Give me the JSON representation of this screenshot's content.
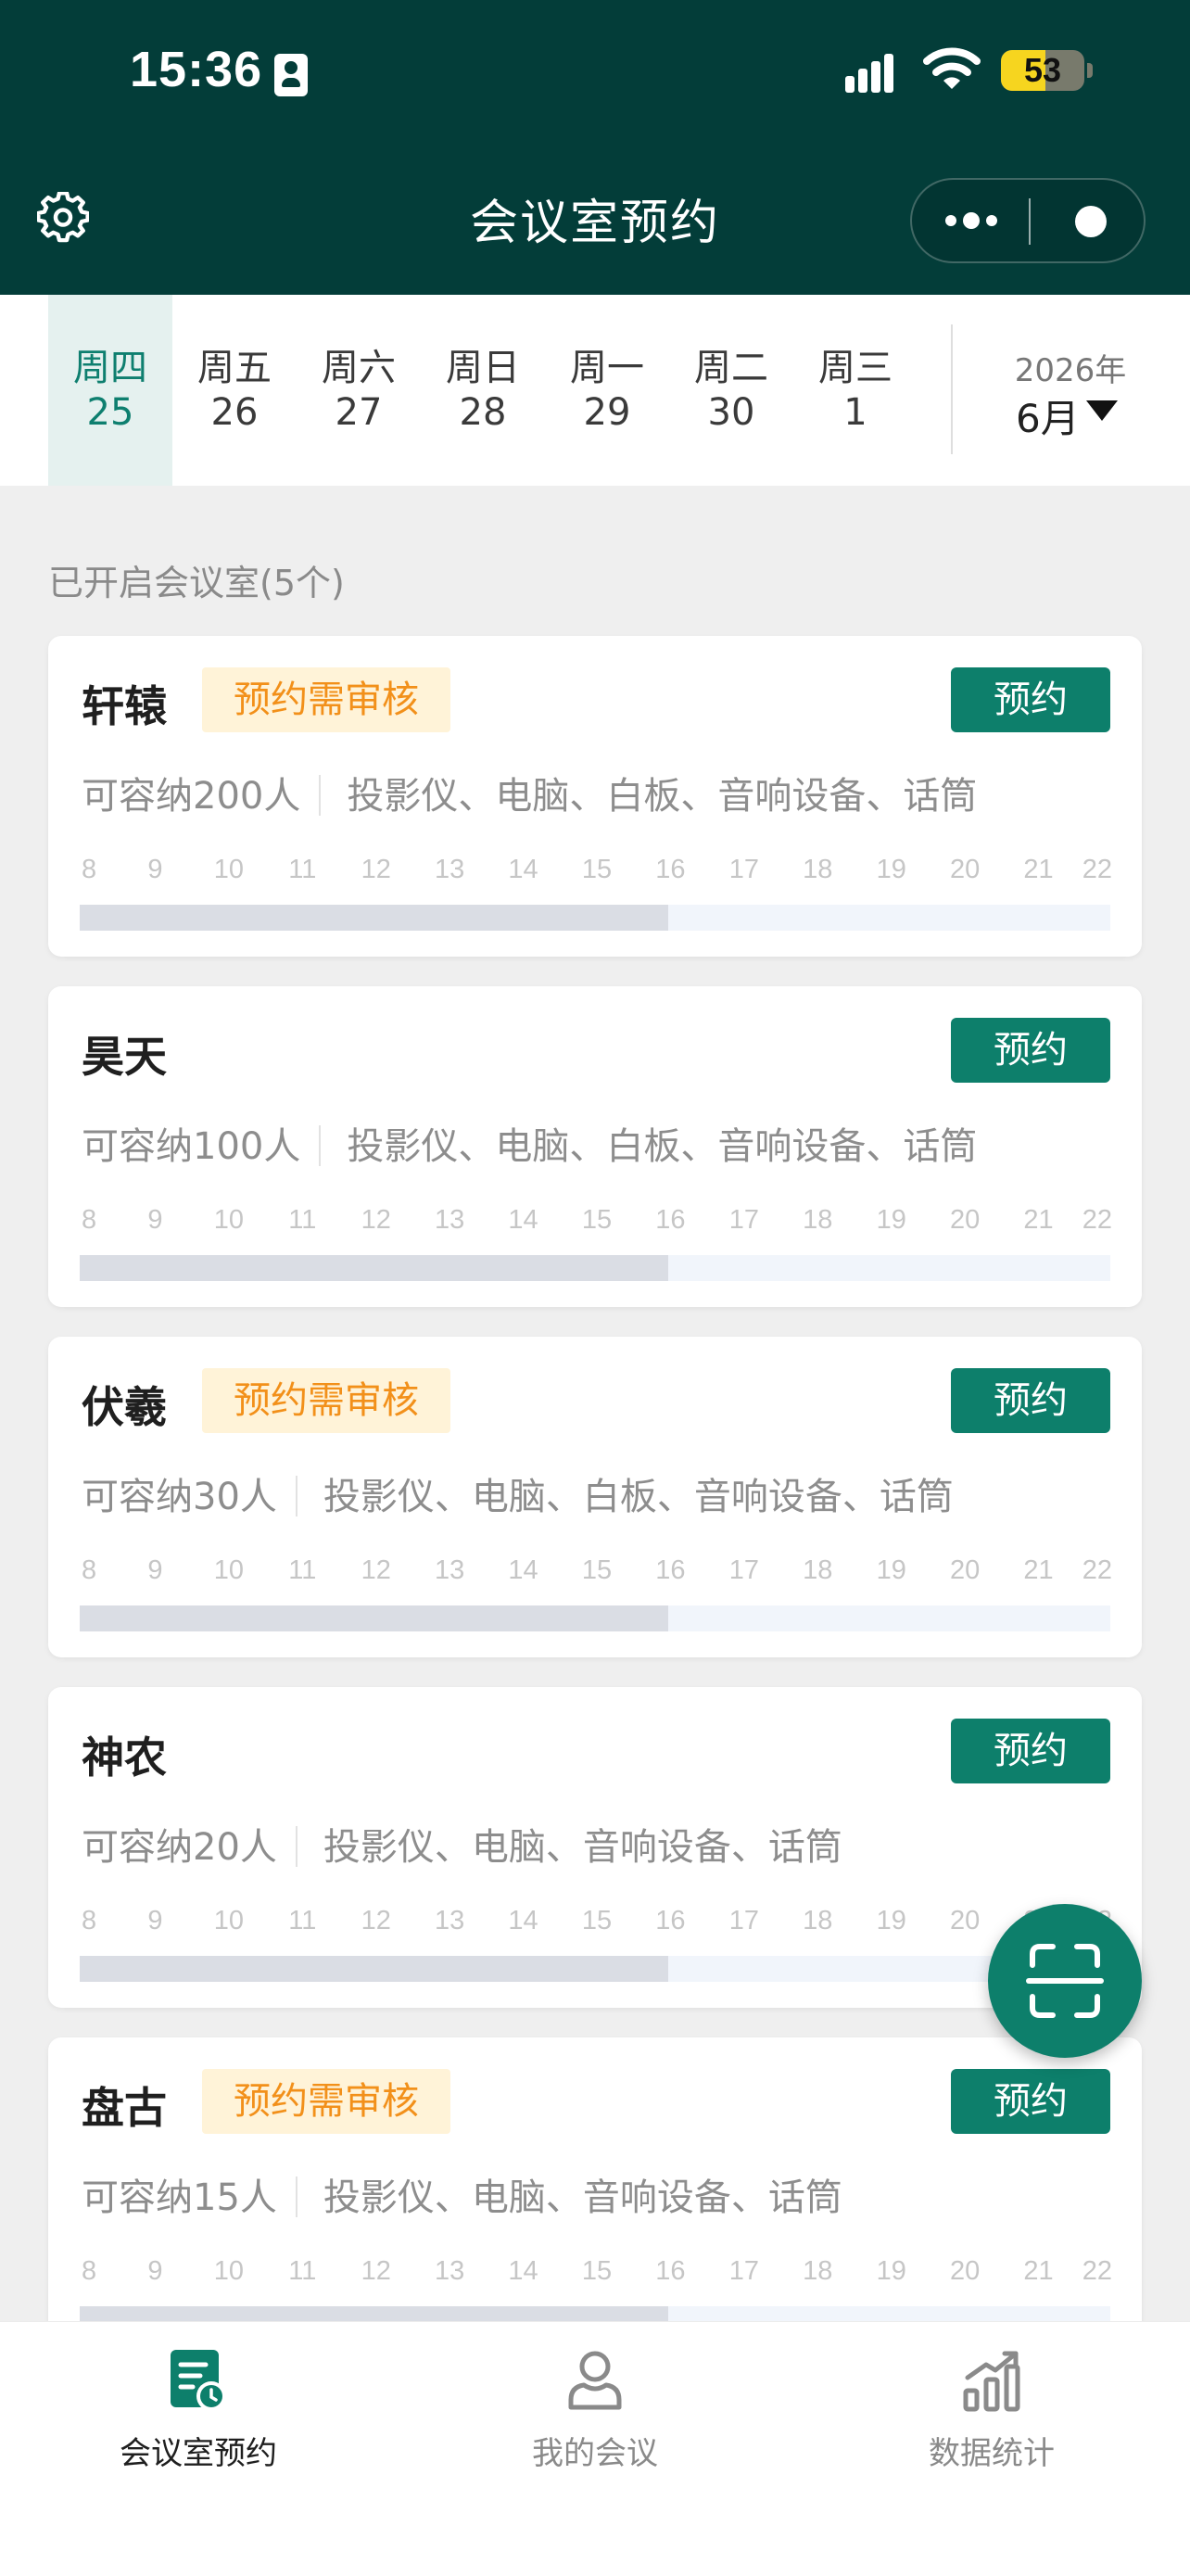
{
  "status_bar": {
    "time": "15:36",
    "battery_level": "53",
    "battery_fraction": 0.53
  },
  "header": {
    "title": "会议室预约",
    "settings_icon": "gear-icon",
    "more_icon": "more-dots-icon",
    "close_icon": "target-circle-icon"
  },
  "calendar": {
    "days": [
      {
        "weekday": "周四",
        "date": "25",
        "active": true
      },
      {
        "weekday": "周五",
        "date": "26",
        "active": false
      },
      {
        "weekday": "周六",
        "date": "27",
        "active": false
      },
      {
        "weekday": "周日",
        "date": "28",
        "active": false
      },
      {
        "weekday": "周一",
        "date": "29",
        "active": false
      },
      {
        "weekday": "周二",
        "date": "30",
        "active": false
      },
      {
        "weekday": "周三",
        "date": "1",
        "active": false
      }
    ],
    "year": "2026年",
    "month": "6月"
  },
  "section_title": "已开启会议室(5个)",
  "timeline": {
    "hours": [
      "8",
      "9",
      "10",
      "11",
      "12",
      "13",
      "14",
      "15",
      "16",
      "17",
      "18",
      "19",
      "20",
      "21",
      "22"
    ],
    "booked_until_hour": 16
  },
  "rooms": [
    {
      "name": "轩辕",
      "badge": "预约需审核",
      "capacity": "可容纳200人",
      "equipment": "投影仪、电脑、白板、音响设备、话筒",
      "book_label": "预约"
    },
    {
      "name": "昊天",
      "badge": "",
      "capacity": "可容纳100人",
      "equipment": "投影仪、电脑、白板、音响设备、话筒",
      "book_label": "预约"
    },
    {
      "name": "伏羲",
      "badge": "预约需审核",
      "capacity": "可容纳30人",
      "equipment": "投影仪、电脑、白板、音响设备、话筒",
      "book_label": "预约"
    },
    {
      "name": "神农",
      "badge": "",
      "capacity": "可容纳20人",
      "equipment": "投影仪、电脑、音响设备、话筒",
      "book_label": "预约"
    },
    {
      "name": "盘古",
      "badge": "预约需审核",
      "capacity": "可容纳15人",
      "equipment": "投影仪、电脑、音响设备、话筒",
      "book_label": "预约"
    }
  ],
  "fab": {
    "icon": "scan-icon"
  },
  "tabbar": {
    "tabs": [
      {
        "label": "会议室预约",
        "icon": "room-booking-icon",
        "active": true
      },
      {
        "label": "我的会议",
        "icon": "person-icon",
        "active": false
      },
      {
        "label": "数据统计",
        "icon": "bar-chart-icon",
        "active": false
      }
    ]
  },
  "colors": {
    "header_bg": "#033d39",
    "accent": "#0d7f6b",
    "badge_text": "#f2901a",
    "badge_bg": "#fff3d8"
  }
}
